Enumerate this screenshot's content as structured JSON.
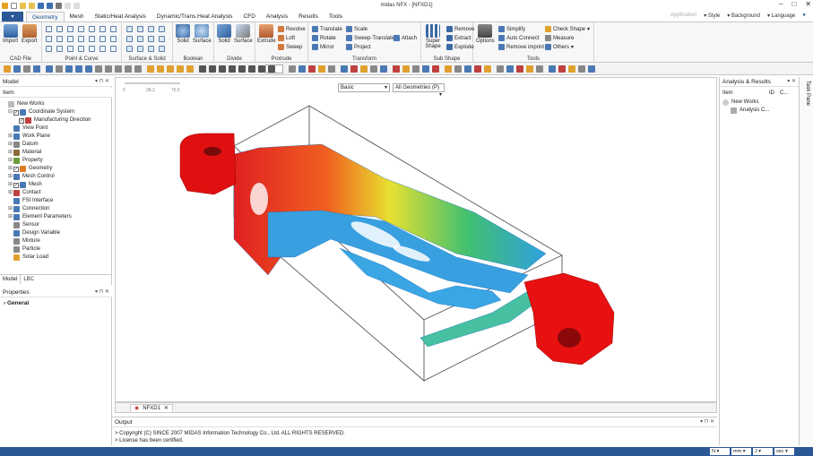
{
  "app": {
    "title": "midas NFX - [NFXD1]"
  },
  "ribbon": {
    "tabs": [
      "Geometry",
      "Mesh",
      "Static/Heat Analysis",
      "Dynamic/Trans.Heat Analysis",
      "CFD",
      "Analysis",
      "Results",
      "Tools"
    ],
    "active_tab": "Geometry",
    "right_menu": {
      "application": "Application",
      "style": "Style",
      "background": "Background",
      "language": "Language"
    },
    "groups": {
      "cad_file": {
        "label": "CAD File",
        "import": "Import",
        "export": "Export"
      },
      "point_curve": {
        "label": "Point & Curve"
      },
      "surface_solid": {
        "label": "Surface & Solid"
      },
      "boolean": {
        "label": "Boolean",
        "solid": "Solid",
        "surface": "Surface"
      },
      "divide": {
        "label": "Divide",
        "solid": "Solid",
        "surface": "Surface"
      },
      "protrude": {
        "label": "Protrude",
        "extrude": "Extrude",
        "revolve": "Revolve",
        "loft": "Loft",
        "sweep": "Sweep"
      },
      "transform": {
        "label": "Transform",
        "translate": "Translate",
        "rotate": "Rotate",
        "mirror": "Mirror",
        "scale": "Scale",
        "sweep_translate": "Sweep-Translate",
        "project": "Project",
        "attach": "Attach"
      },
      "sub_shape": {
        "label": "Sub Shape",
        "super_shape": "Super Shape",
        "remove": "Remove",
        "extract": "Extract",
        "explode": "Explode"
      },
      "tools": {
        "label": "Tools",
        "options": "Options",
        "simplify": "Simplify",
        "auto_connect": "Auto Connect",
        "remove_imprint": "Remove imprint",
        "check_shape": "Check Shape",
        "measure": "Measure",
        "others": "Others"
      }
    }
  },
  "toolbar": {
    "number": "15"
  },
  "model_panel": {
    "title": "Model",
    "column": "Item",
    "tree": [
      "New Works",
      "Coordinate System",
      "Manufacturing Direction",
      "View Point",
      "Work Plane",
      "Datum",
      "Material",
      "Property",
      "Geometry",
      "Mesh Control",
      "Mesh",
      "Contact",
      "FSI Interface",
      "Connection",
      "Element Parameters",
      "Sensor",
      "Design Variable",
      "Mixture",
      "Particle",
      "Solar Load"
    ],
    "tabs": [
      "Model",
      "LBC"
    ]
  },
  "properties_panel": {
    "title": "Properties",
    "section": "General"
  },
  "viewport": {
    "scale": [
      "0",
      "38.2",
      "76.5"
    ],
    "display_mode": "Basic",
    "filter": "All Geometries (P)",
    "doc_tab": "NFXD1"
  },
  "analysis_panel": {
    "title": "Analysis & Results",
    "columns": [
      "Item",
      "ID",
      "C..."
    ],
    "root": "New Works",
    "child": "Analysis C..."
  },
  "side_tab": "Task Pane",
  "output": {
    "title": "Output",
    "lines": [
      "> Copyright (C) SINCE 2007 MIDAS Information Technology Co., Ltd. ALL RIGHTS RESERVED.",
      "> License has been certified."
    ]
  },
  "status": {
    "unit_force": "N",
    "unit_length": "mm",
    "unit_energy": "J",
    "unit_time": "sec"
  }
}
